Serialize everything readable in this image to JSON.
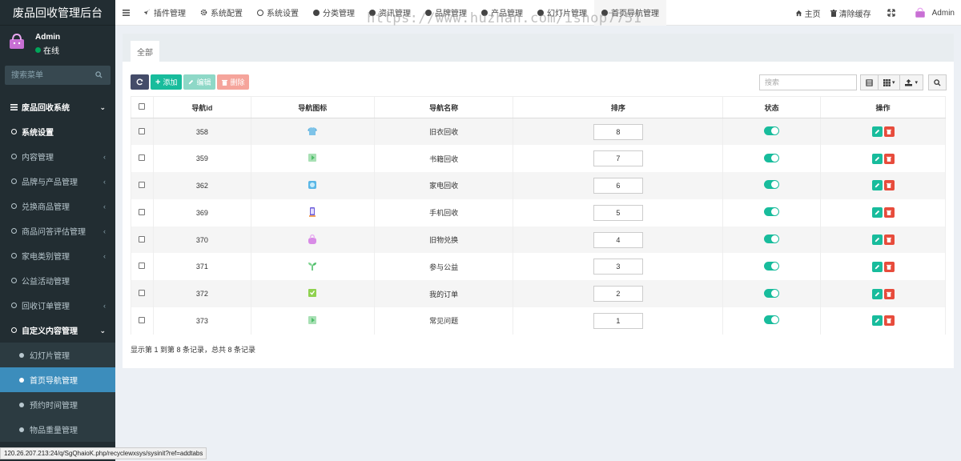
{
  "sidebar": {
    "brand": "废品回收管理后台",
    "user_name": "Admin",
    "user_status": "在线",
    "search_placeholder": "搜索菜单",
    "items": [
      {
        "label": "废品回收系统",
        "kind": "header"
      },
      {
        "label": "系统设置",
        "kind": "bold"
      },
      {
        "label": "内容管理",
        "kind": "normal"
      },
      {
        "label": "品牌与产品管理",
        "kind": "normal"
      },
      {
        "label": "兑换商品管理",
        "kind": "normal"
      },
      {
        "label": "商品问答评估管理",
        "kind": "normal"
      },
      {
        "label": "家电类别管理",
        "kind": "normal"
      },
      {
        "label": "公益活动管理",
        "kind": "normal"
      },
      {
        "label": "回收订单管理",
        "kind": "normal"
      },
      {
        "label": "自定义内容管理",
        "kind": "bold"
      },
      {
        "label": "幻灯片管理",
        "kind": "sub"
      },
      {
        "label": "首页导航管理",
        "kind": "sub-active"
      },
      {
        "label": "预约时间管理",
        "kind": "sub"
      },
      {
        "label": "物品重量管理",
        "kind": "sub"
      }
    ]
  },
  "status_url": "120.26.207.213:24/q/SgQhaioK.php/recyclewxsys/sysinit?ref=addtabs",
  "topbar": {
    "tabs": [
      {
        "label": "插件管理",
        "icon": "rocket-icon"
      },
      {
        "label": "系统配置",
        "icon": "gear-icon"
      },
      {
        "label": "系统设置",
        "icon": "circle-icon"
      },
      {
        "label": "分类管理",
        "icon": "dot-icon"
      },
      {
        "label": "资讯管理",
        "icon": "dot-icon"
      },
      {
        "label": "品牌管理",
        "icon": "dot-icon"
      },
      {
        "label": "产品管理",
        "icon": "dot-icon"
      },
      {
        "label": "幻灯片管理",
        "icon": "dot-icon"
      },
      {
        "label": "首页导航管理",
        "icon": "dot-icon"
      }
    ],
    "home_label": "主页",
    "clear_cache_label": "清除缓存",
    "admin_label": "Admin"
  },
  "watermark": "https://www.huzhan.com/ishop7751",
  "panel": {
    "tab_label": "全部",
    "buttons": {
      "add": "添加",
      "edit": "编辑",
      "delete": "删除"
    },
    "search_placeholder": "搜索",
    "table": {
      "columns": [
        "导航id",
        "导航图标",
        "导航名称",
        "排序",
        "状态",
        "操作"
      ],
      "rows": [
        {
          "id": "358",
          "icon": "clothes-icon",
          "name": "旧衣回收",
          "sort": "8",
          "status": "on"
        },
        {
          "id": "359",
          "icon": "book-icon",
          "name": "书籍回收",
          "sort": "7",
          "status": "on"
        },
        {
          "id": "362",
          "icon": "appliance-icon",
          "name": "家电回收",
          "sort": "6",
          "status": "on"
        },
        {
          "id": "369",
          "icon": "phone-icon",
          "name": "手机回收",
          "sort": "5",
          "status": "on"
        },
        {
          "id": "370",
          "icon": "exchange-bag-icon",
          "name": "旧物兑换",
          "sort": "4",
          "status": "on"
        },
        {
          "id": "371",
          "icon": "sprout-icon",
          "name": "参与公益",
          "sort": "3",
          "status": "on"
        },
        {
          "id": "372",
          "icon": "order-icon",
          "name": "我的订单",
          "sort": "2",
          "status": "on"
        },
        {
          "id": "373",
          "icon": "faq-icon",
          "name": "常见问题",
          "sort": "1",
          "status": "on"
        }
      ]
    },
    "pager_text": "显示第 1 到第 8 条记录，总共 8 条记录"
  },
  "colors": {
    "sidebar_bg": "#222d32",
    "active_menu": "#3c8dbc",
    "success": "#18bc9c",
    "danger": "#e74c3c"
  }
}
